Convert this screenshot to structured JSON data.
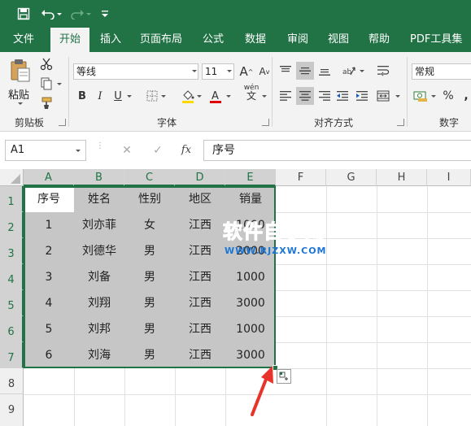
{
  "ribbon_tabs": [
    "文件",
    "开始",
    "插入",
    "页面布局",
    "公式",
    "数据",
    "审阅",
    "视图",
    "帮助",
    "PDF工具集"
  ],
  "clipboard": {
    "paste_label": "粘贴",
    "group_label": "剪贴板"
  },
  "font": {
    "name": "等线",
    "size": "11",
    "group_label": "字体",
    "increase_label": "A",
    "decrease_label": "A",
    "bold": "B",
    "italic": "I",
    "underline": "U",
    "phonetic_top": "wén",
    "phonetic_bottom": "文"
  },
  "alignment": {
    "group_label": "对齐方式"
  },
  "number": {
    "format": "常规",
    "group_label": "数字",
    "percent": "%",
    "comma": ","
  },
  "formula_bar": {
    "name_box": "A1",
    "cancel": "✕",
    "enter": "✓",
    "fx": "fx",
    "content": "序号"
  },
  "columns": [
    "A",
    "B",
    "C",
    "D",
    "E",
    "F",
    "G",
    "H",
    "I"
  ],
  "rows": [
    "1",
    "2",
    "3",
    "4",
    "5",
    "6",
    "7",
    "8",
    "9"
  ],
  "table": {
    "header": [
      "序号",
      "姓名",
      "性别",
      "地区",
      "销量"
    ],
    "rows": [
      [
        "1",
        "刘亦菲",
        "女",
        "江西",
        "1000"
      ],
      [
        "2",
        "刘德华",
        "男",
        "江西",
        "2000"
      ],
      [
        "3",
        "刘备",
        "男",
        "江西",
        "1000"
      ],
      [
        "4",
        "刘翔",
        "男",
        "江西",
        "3000"
      ],
      [
        "5",
        "刘邦",
        "男",
        "江西",
        "1000"
      ],
      [
        "6",
        "刘海",
        "男",
        "江西",
        "3000"
      ]
    ]
  },
  "watermark": {
    "title": "软件自学网",
    "url": "WWW.RJZXW.COM"
  },
  "colors": {
    "excel_green": "#217346",
    "selection_fill": "#c6c6c6",
    "arrow_red": "#e8332a",
    "watermark_blue": "#1b76d4"
  },
  "icons": [
    "save-icon",
    "undo-icon",
    "redo-icon",
    "customize-qat-icon",
    "paste-icon",
    "cut-icon",
    "copy-icon",
    "format-painter-icon",
    "border-icon",
    "fill-color-icon",
    "font-color-icon",
    "wrap-text-icon",
    "merge-icon",
    "accounting-icon",
    "quick-analysis-icon",
    "red-arrow-icon"
  ]
}
